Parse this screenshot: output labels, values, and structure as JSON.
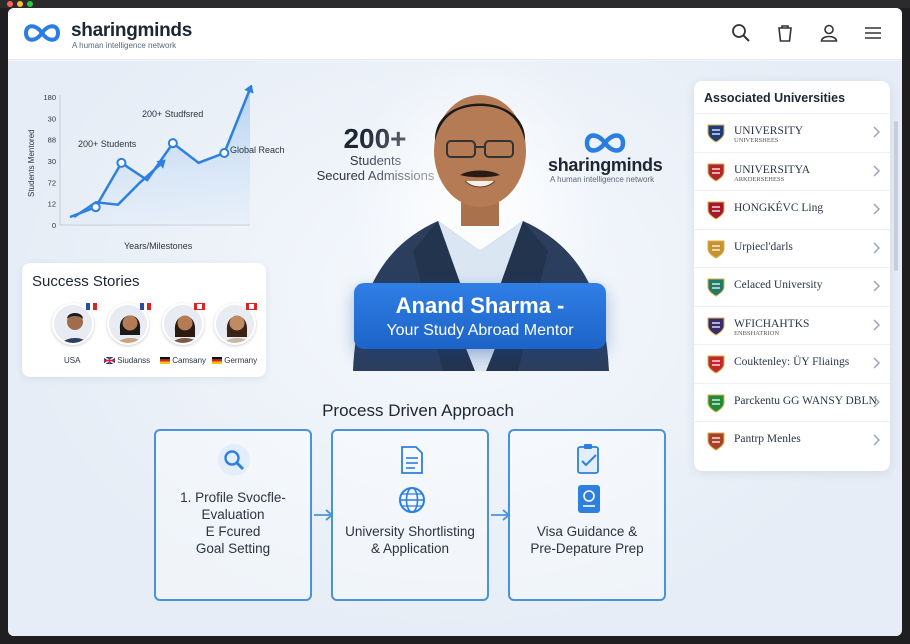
{
  "brand": {
    "name": "sharingminds",
    "tagline": "A human intelligence network"
  },
  "header": {
    "icons": [
      "search-icon",
      "bag-icon",
      "user-icon",
      "menu-icon"
    ]
  },
  "chart_data": {
    "type": "line",
    "ylabel": "Students Mentored",
    "xlabel": "Years/Milestones",
    "yticks": [
      "0",
      "12",
      "72",
      "30",
      "88",
      "30",
      "180"
    ],
    "annotations": [
      "200+ Students",
      "200+ Studfsred",
      "Global Reach"
    ],
    "series": [
      {
        "values": [
          0,
          20,
          110,
          75,
          150,
          110,
          130,
          260
        ]
      },
      {
        "values": [
          0,
          30,
          25,
          70,
          110
        ]
      }
    ]
  },
  "stats": {
    "number": "200+",
    "label_line1": "Students",
    "label_line2": "Secured Admissions"
  },
  "center_brand": {
    "name": "sharingminds",
    "tagline": "A human intelligence network"
  },
  "mentor": {
    "name": "Anand Sharma -",
    "role": "Your Study Abroad Mentor"
  },
  "success_stories": {
    "title": "Success Stories",
    "people": [
      {
        "country": "USA"
      },
      {
        "country": "Siudanss"
      },
      {
        "country": "Camsany"
      },
      {
        "country": "Germany"
      }
    ]
  },
  "process": {
    "title": "Process Driven Approach",
    "steps": [
      {
        "line1": "1. Profile Svocfle-",
        "line2": "Evaluation",
        "line3": "Ε Fcured",
        "line4": "Goal Setting"
      },
      {
        "line1": "University Shortlisting",
        "line2": "& Application"
      },
      {
        "line1": "Visa Guidance &",
        "line2": "Pre-Depature Prep"
      }
    ]
  },
  "universities": {
    "title": "Associated Universities",
    "items": [
      {
        "name": "UNIVERSITY",
        "sub": "UNIVERSHEES",
        "color": "#1c3d7a"
      },
      {
        "name": "UNIVERSITYA",
        "sub": "ARKDERSEHESS",
        "color": "#b0262c"
      },
      {
        "name": "HONGKÉVC Ling",
        "sub": "",
        "color": "#a3182d"
      },
      {
        "name": "Urpiecl'darls",
        "sub": "",
        "color": "#c8932e"
      },
      {
        "name": "Celaced University",
        "sub": "",
        "color": "#1f7a6a"
      },
      {
        "name": "WFICHAHTKS",
        "sub": "ENBSHATRION",
        "color": "#3a2a6e"
      },
      {
        "name": "Couktenley: ÜY Fliaings",
        "sub": "",
        "color": "#c0282a"
      },
      {
        "name": "Parckentu  GG  WANSY DBLN",
        "sub": "",
        "color": "#1f8a3a"
      },
      {
        "name": "Pantrp Menles",
        "sub": "",
        "color": "#a8402a"
      }
    ]
  }
}
